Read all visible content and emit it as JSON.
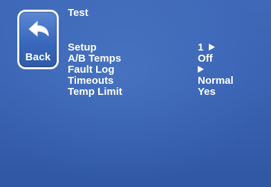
{
  "screen": {
    "title": "Test"
  },
  "back_button": {
    "label": "Back",
    "icon": "back-arrow-icon"
  },
  "menu": {
    "items": [
      {
        "label": "Setup",
        "value": "1",
        "arrow": true
      },
      {
        "label": "A/B Temps",
        "value": "Off",
        "arrow": false
      },
      {
        "label": "Fault Log",
        "value": "",
        "arrow": true
      },
      {
        "label": "Timeouts",
        "value": "Normal",
        "arrow": false
      },
      {
        "label": "Temp Limit",
        "value": "Yes",
        "arrow": false
      }
    ]
  },
  "colors": {
    "background": "#3a63b3",
    "text": "#ffffff",
    "button_border": "#f4f7ff"
  }
}
